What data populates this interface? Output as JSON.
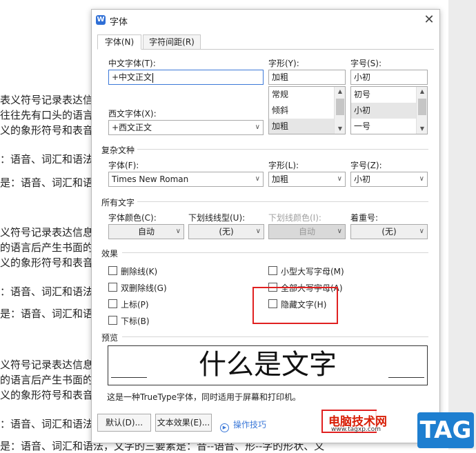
{
  "document": {
    "lines": [
      "表义符号记录表达信",
      "往往先有口头的语言",
      "义的象形符号和表音",
      "：语音、词汇和语法",
      "是：语音、词汇和语",
      "义符号记录表达信息",
      "的语言后产生书面的",
      "义的象形符号和表音",
      "：语音、词汇和语法",
      "是：语音、词汇和语",
      "义符号记录表达信息",
      "的语言后产生书面的",
      "义的象形符号和表音",
      "：语音、词汇和语法",
      "是：语音、词汇和语法，文字的三要素是：音--语音、形--字的形状、义"
    ]
  },
  "dialog": {
    "title": "字体",
    "logo": "W",
    "close_icon": "✕",
    "tabs": [
      "字体(N)",
      "字符间距(R)"
    ],
    "chinese_font": {
      "label": "中文字体(T):",
      "value": "+中文正文"
    },
    "style": {
      "label": "字形(Y):",
      "value": "加粗",
      "options": [
        "常规",
        "倾斜",
        "加粗"
      ],
      "selected": "加粗"
    },
    "size": {
      "label": "字号(S):",
      "value": "小初",
      "options": [
        "初号",
        "小初",
        "一号"
      ],
      "selected": "小初"
    },
    "western_font": {
      "label": "西文字体(X):",
      "value": "+西文正文"
    },
    "complex": {
      "section": "复杂文种",
      "font_label": "字体(F):",
      "font_value": "Times New Roman",
      "style_label": "字形(L):",
      "style_value": "加粗",
      "size_label": "字号(Z):",
      "size_value": "小初"
    },
    "all_text": {
      "section": "所有文字",
      "color_label": "字体颜色(C):",
      "color_value": "自动",
      "underline_label": "下划线线型(U):",
      "underline_value": "(无)",
      "underline_color_label": "下划线颜色(I):",
      "underline_color_value": "自动",
      "emphasis_label": "着重号:",
      "emphasis_value": "(无)"
    },
    "effects": {
      "section": "效果",
      "left": [
        "删除线(K)",
        "双删除线(G)",
        "上标(P)",
        "下标(B)"
      ],
      "right": [
        "小型大写字母(M)",
        "全部大写字母(A)",
        "隐藏文字(H)"
      ]
    },
    "preview": {
      "section": "预览",
      "text": "什么是文字"
    },
    "note": "这是一种TrueType字体，同时适用于屏幕和打印机。",
    "buttons": {
      "default": "默认(D)...",
      "text_effect": "文本效果(E)...",
      "tips": "操作技巧"
    }
  },
  "watermark": {
    "site": "电脑技术网",
    "url": "www.tagxp.com",
    "tag": "TAG"
  },
  "colors": {
    "highlight": "#e02020",
    "accent": "#3b78d8",
    "tag_bg": "#1e7fd0"
  }
}
